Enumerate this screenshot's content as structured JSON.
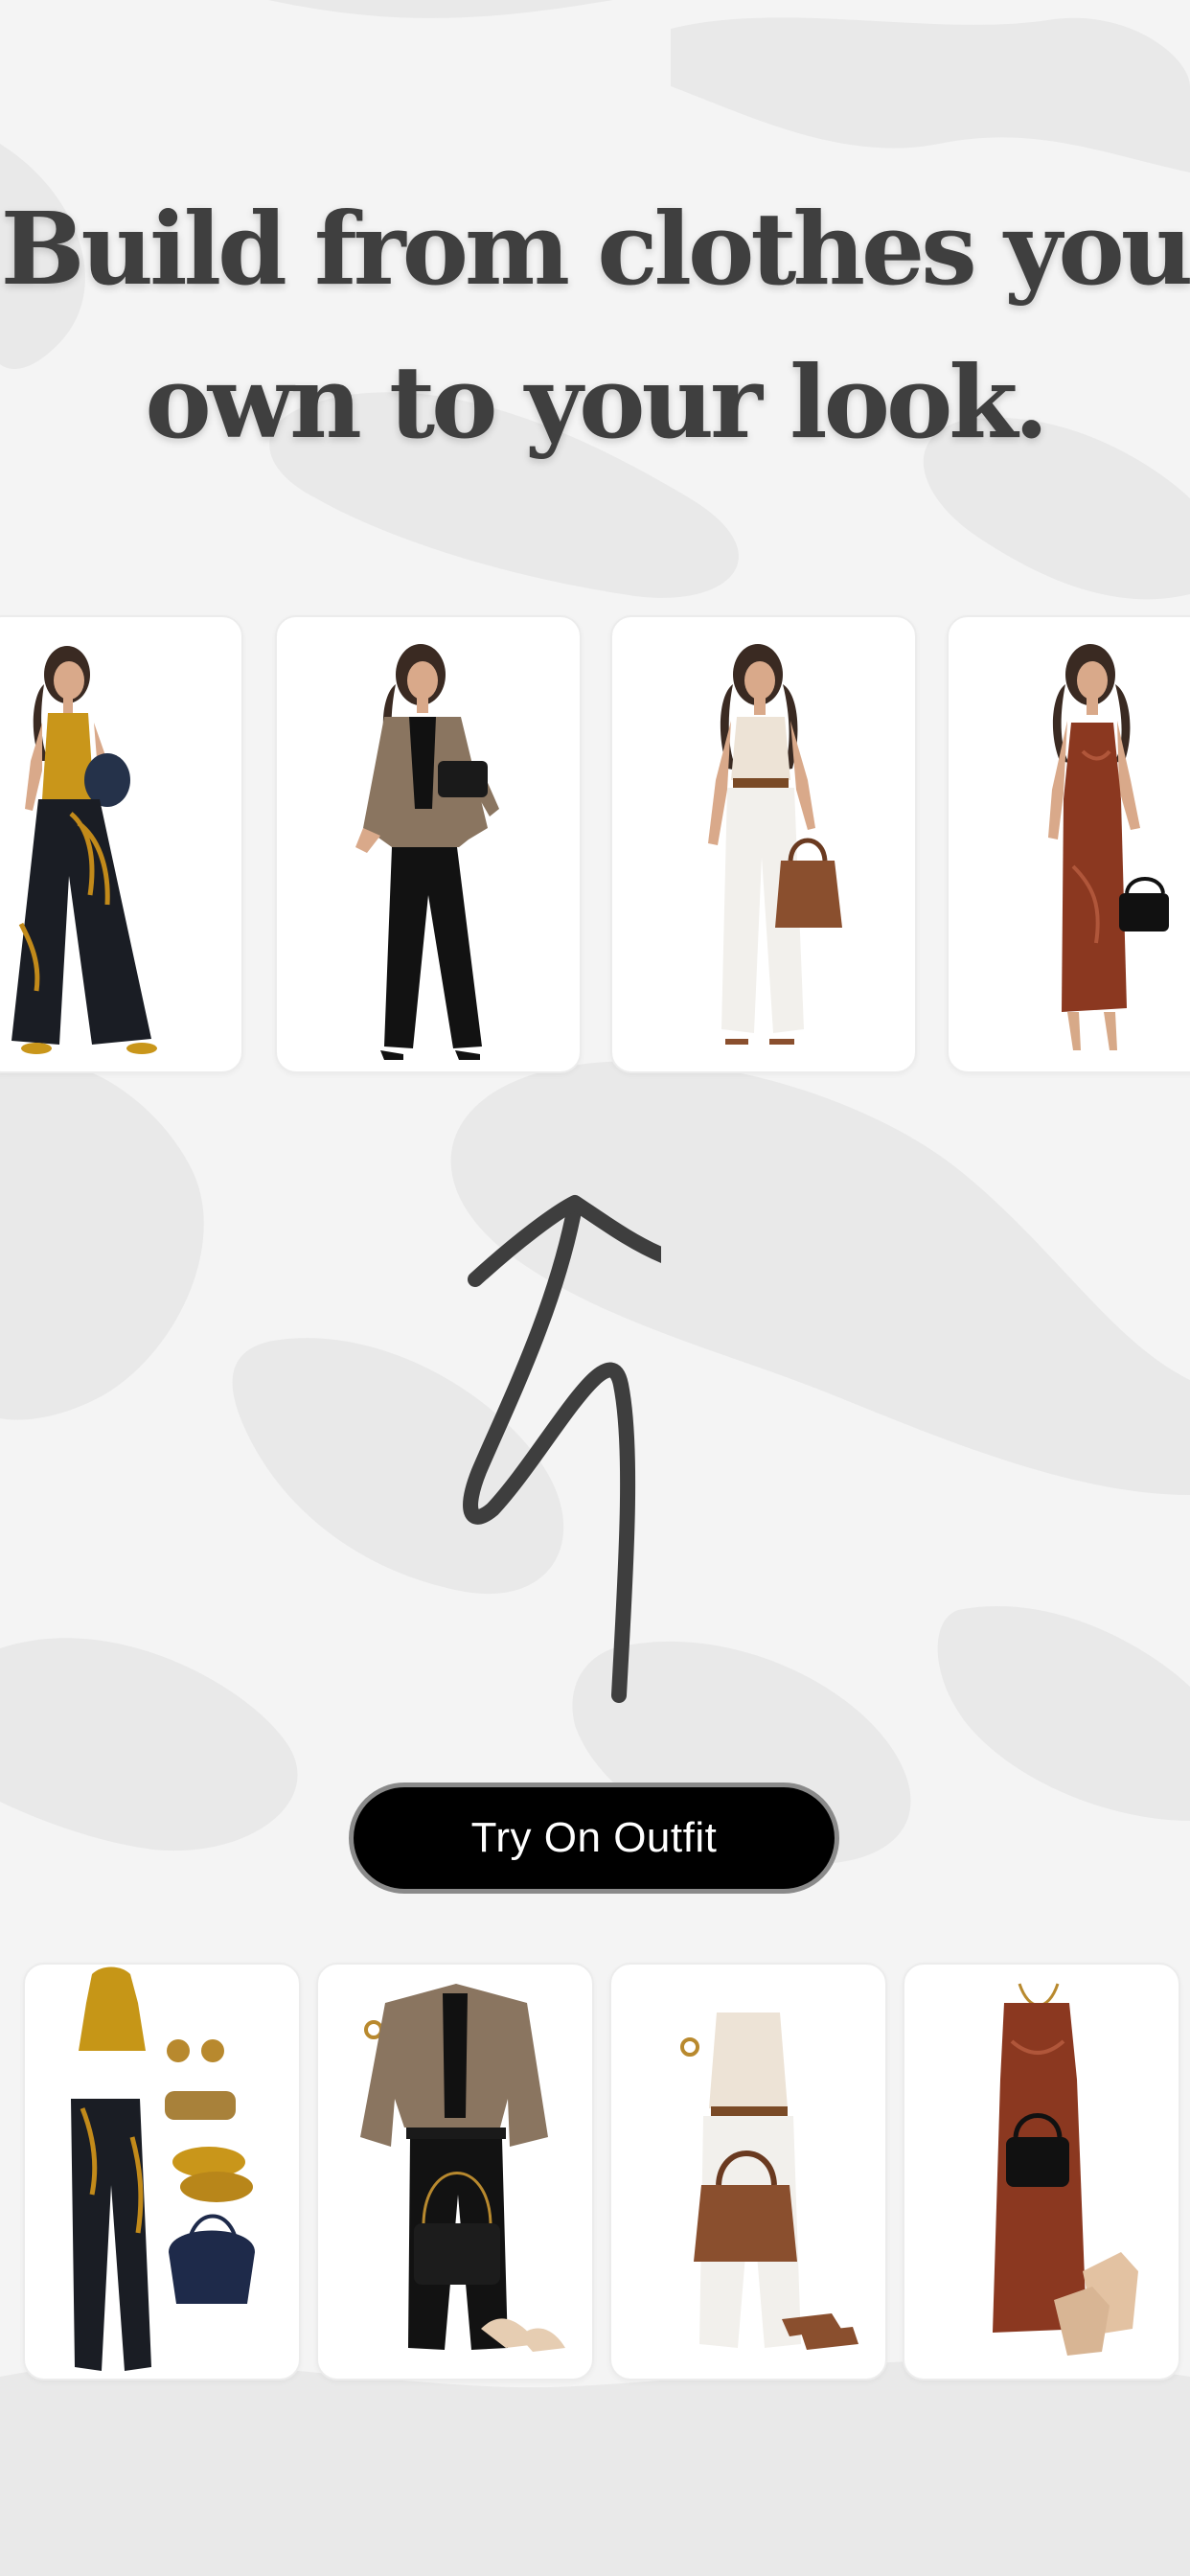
{
  "headline": {
    "line1": "Build from clothes you",
    "line2": "own to your look."
  },
  "looks": [
    {
      "name": "look-mustard-halter-wide-leg"
    },
    {
      "name": "look-tweed-blazer-trousers"
    },
    {
      "name": "look-cream-tank-white-pants"
    },
    {
      "name": "look-rust-satin-slip-dress"
    }
  ],
  "flatlays": [
    {
      "name": "flatlay-mustard-halter-set"
    },
    {
      "name": "flatlay-tweed-blazer-set"
    },
    {
      "name": "flatlay-cream-tank-set"
    },
    {
      "name": "flatlay-rust-slip-dress-set"
    }
  ],
  "cta": {
    "label": "Try On Outfit"
  },
  "icons": {
    "arrow": "hand-drawn-arrow-icon"
  },
  "colors": {
    "background": "#f4f4f4",
    "cta_bg": "#000000",
    "cta_border": "#8a8a8a",
    "text": "#3f3f3f"
  }
}
